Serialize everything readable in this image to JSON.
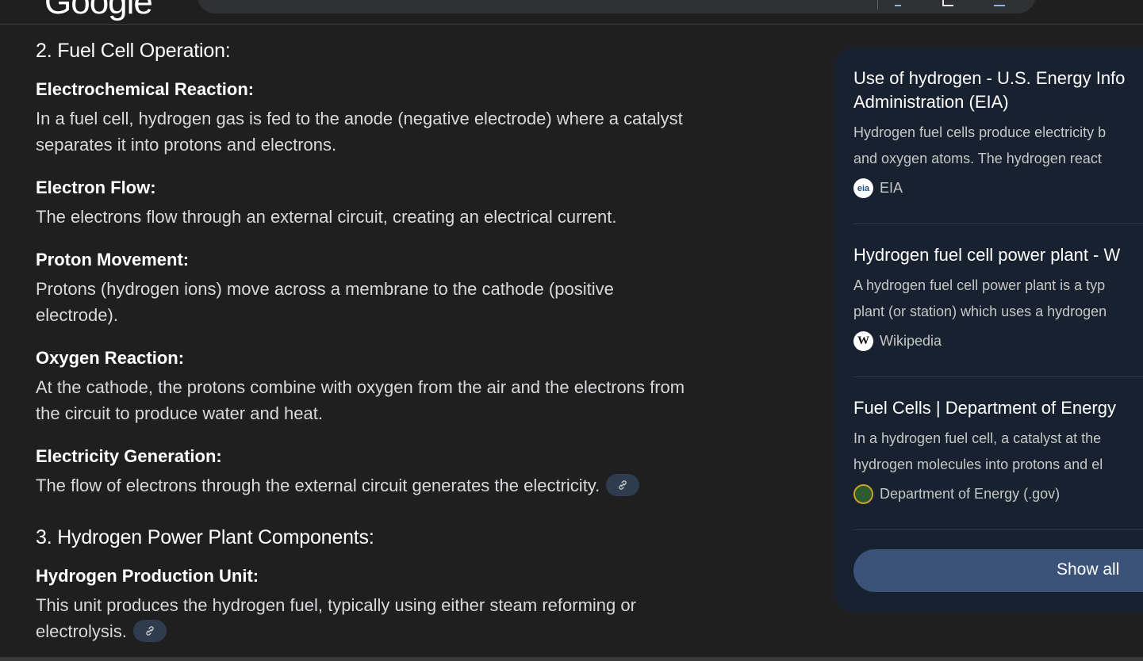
{
  "header": {
    "logo_text": "Google"
  },
  "main": {
    "section2_heading": "2. Fuel Cell Operation:",
    "items": [
      {
        "title": "Electrochemical Reaction:",
        "lines": [
          "In a fuel cell, hydrogen gas is fed to the anode (negative electrode) where a catalyst",
          "separates it into protons and electrons."
        ]
      },
      {
        "title": "Electron Flow:",
        "lines": [
          "The electrons flow through an external circuit, creating an electrical current."
        ]
      },
      {
        "title": "Proton Movement:",
        "lines": [
          "Protons (hydrogen ions) move across a membrane to the cathode (positive",
          "electrode)."
        ]
      },
      {
        "title": "Oxygen Reaction:",
        "lines": [
          "At the cathode, the protons combine with oxygen from the air and the electrons from",
          "the circuit to produce water and heat."
        ]
      },
      {
        "title": "Electricity Generation:",
        "lines": [
          "The flow of electrons through the external circuit generates the electricity."
        ]
      }
    ],
    "section3_heading": "3. Hydrogen Power Plant Components:",
    "item6": {
      "title": "Hydrogen Production Unit:",
      "lines": [
        "This unit produces the hydrogen fuel, typically using either steam reforming or",
        "electrolysis."
      ]
    }
  },
  "sources": {
    "items": [
      {
        "title_lines": [
          "Use of hydrogen - U.S. Energy Info",
          "Administration (EIA)"
        ],
        "snippet_lines": [
          "Hydrogen fuel cells produce electricity b",
          "and oxygen atoms. The hydrogen react"
        ],
        "source": "EIA",
        "favicon_text": "eia"
      },
      {
        "title_lines": [
          "Hydrogen fuel cell power plant - W"
        ],
        "snippet_lines": [
          "A hydrogen fuel cell power plant is a typ",
          "plant (or station) which uses a hydrogen"
        ],
        "source": "Wikipedia",
        "favicon_text": "W"
      },
      {
        "title_lines": [
          "Fuel Cells | Department of Energy"
        ],
        "snippet_lines": [
          "In a hydrogen fuel cell, a catalyst at the",
          "hydrogen molecules into protons and el"
        ],
        "source": "Department of Energy (.gov)",
        "favicon_text": ""
      }
    ],
    "show_all_label": "Show all"
  }
}
